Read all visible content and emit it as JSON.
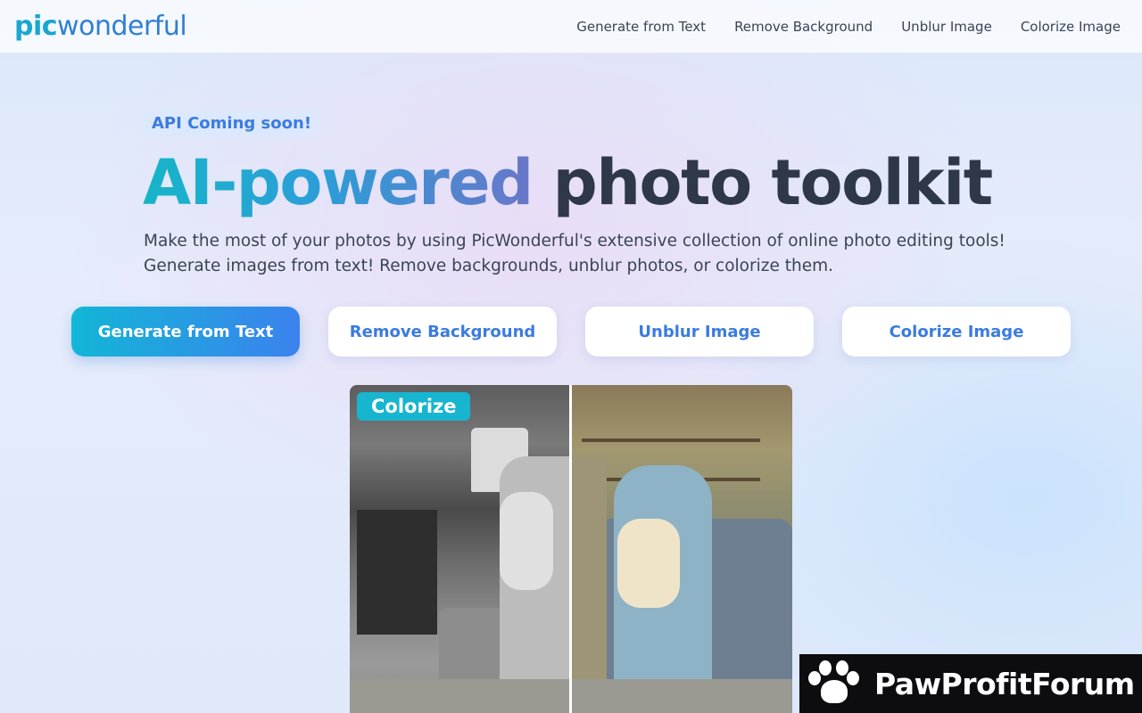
{
  "header": {
    "logo": {
      "part1": "pic",
      "part2": "wonderful"
    },
    "nav": [
      "Generate from Text",
      "Remove Background",
      "Unblur Image",
      "Colorize Image"
    ]
  },
  "hero": {
    "badge": "API Coming soon!",
    "headline_gradient": "AI-powered",
    "headline_rest": "photo toolkit",
    "description_line1": "Make the most of your photos by using PicWonderful's extensive collection of online photo editing tools!",
    "description_line2": "Generate images from text! Remove backgrounds, unblur photos, or colorize them."
  },
  "tools": [
    {
      "label": "Generate from Text",
      "style": "primary"
    },
    {
      "label": "Remove Background",
      "style": "secondary"
    },
    {
      "label": "Unblur Image",
      "style": "secondary"
    },
    {
      "label": "Colorize Image",
      "style": "secondary"
    }
  ],
  "preview": {
    "tag": "Colorize"
  },
  "watermark": {
    "text": "PawProfitForum",
    "icon": "paw-icon"
  },
  "colors": {
    "accent": "#3b7be0",
    "teal": "#17b5cf",
    "text_dark": "#2e3848"
  }
}
